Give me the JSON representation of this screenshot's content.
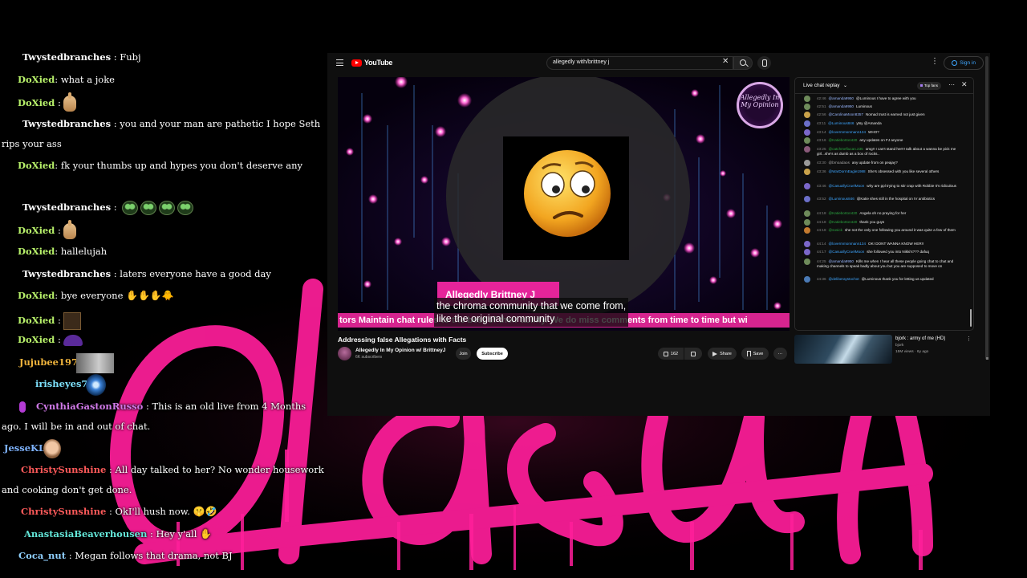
{
  "background": {
    "graffiti_text": "Old Soul",
    "accent": "#ff1e9a"
  },
  "chat": [
    {
      "user": "Twystedbranches",
      "color": "#ffffff",
      "text": ": Fubj"
    },
    {
      "user": "DoXied",
      "color": "#b7f06a",
      "text": ": what a joke"
    },
    {
      "user": "DoXied",
      "color": "#b7f06a",
      "text": ":"
    },
    {
      "user": "Twystedbranches",
      "color": "#ffffff",
      "text": ": you and your man are pathetic I hope Seth",
      "text2": "rips your ass"
    },
    {
      "user": "DoXied",
      "color": "#b7f06a",
      "text": ": fk your thumbs up and hypes you don't deserve any"
    },
    {
      "user": "Twystedbranches",
      "color": "#ffffff",
      "text": ":"
    },
    {
      "user": "DoXied",
      "color": "#b7f06a",
      "text": ":"
    },
    {
      "user": "DoXied",
      "color": "#b7f06a",
      "text": ": hallelujah"
    },
    {
      "user": "Twystedbranches",
      "color": "#ffffff",
      "text": ": laters everyone have a good day"
    },
    {
      "user": "DoXied",
      "color": "#b7f06a",
      "text": ": bye everyone"
    },
    {
      "user": "DoXied",
      "color": "#b7f06a",
      "text": ":"
    },
    {
      "user": "DoXied",
      "color": "#b7f06a",
      "text": ":"
    },
    {
      "user": "Jujubee1973",
      "color": "#f0b43c",
      "text": ":"
    },
    {
      "user": "irisheyes78",
      "color": "#7fe3ff",
      "text": ":"
    },
    {
      "user": "CynthiaGastonRusso",
      "color": "#d07ae8",
      "text": ": This is an old live from 4 Months",
      "text2": "ago. I will be in and out of chat."
    },
    {
      "user": "JesseKL",
      "color": "#7fb4ff",
      "text": ":"
    },
    {
      "user": "ChristySunshine",
      "color": "#ff5a5a",
      "text": ": All day talked to her? No wonder housework",
      "text2": "and cooking don't get done."
    },
    {
      "user": "ChristySunshine",
      "color": "#ff5a5a",
      "text": ": OkI'll hush now."
    },
    {
      "user": "AnastasiaBeaverhousen",
      "color": "#63e6d8",
      "text": ": Hey y'all"
    },
    {
      "user": "Coca_nut",
      "color": "#8fd0ff",
      "text": ": Megan follows that drama, not BJ"
    }
  ],
  "youtube": {
    "logo": "YouTube",
    "search_value": "allegedly with/brittney j",
    "signin": "Sign in",
    "video": {
      "lower_title": "Allegedly Brittney J",
      "ticker": "tors Maintain chat rules to the best of their ability. We do miss comments from time to time but wi",
      "caption_1": "the chroma community that we come from,",
      "caption_2": "like the original community",
      "seal": "Allegedly In My Opinion"
    },
    "title": "Addressing false Allegations with Facts",
    "channel": "Allegedly In My Opinion w/ BrittneyJ",
    "subs": "6K subscribers",
    "join": "Join",
    "subscribe": "Subscribe",
    "likes": "162",
    "share": "Share",
    "save": "Save",
    "live_chat": {
      "title": "Live chat replay",
      "top_fans": "Top fans",
      "messages": [
        {
          "ts": "42:46",
          "name": "@amanda9950",
          "color": "#9ab8ff",
          "text": "@Luminous I have to agree with you"
        },
        {
          "ts": "42:51",
          "name": "@amanda9950",
          "color": "#9ab8ff",
          "text": "Luminous"
        },
        {
          "ts": "42:56",
          "name": "@CarolinaMoon8357",
          "color": "#9ab8ff",
          "text": "Nomad trust is earned not just given"
        },
        {
          "ts": "43:11",
          "name": "@Luminous846",
          "color": "#3ea6ff",
          "text": "ytsy @Amanda"
        },
        {
          "ts": "43:14",
          "name": "@lovermmonmann134",
          "color": "#3ea6ff",
          "text": "WHO?"
        },
        {
          "ts": "43:16",
          "name": "@Katieborton420",
          "color": "#2ba640",
          "text": "any updates on FJ anyone"
        },
        {
          "ts": "43:25",
          "name": "@catchmefiucan.235",
          "color": "#2ba640",
          "text": "omg!! I can't stand her!!! talk about a wanna be pick me girl...she's as dumb as a box of rocks.."
        },
        {
          "ts": "43:30",
          "name": "@brnoadaos",
          "color": "#aaaaaa",
          "text": "any update from on peajay?"
        },
        {
          "ts": "43:36",
          "name": "@WarDormEagle1988",
          "color": "#3ea6ff",
          "text": "She's obsessed with you like several others"
        },
        {
          "ts": "43:46",
          "name": "@CasuallyCruelMoon",
          "color": "#3ea6ff",
          "text": "why are ppl trying to stir crap with Robbie It's ridiculous"
        },
        {
          "ts": "43:52",
          "name": "@Luminous846",
          "color": "#3ea6ff",
          "text": "@Katie shes still in the hospital on IV antibiotics"
        },
        {
          "ts": "44:18",
          "name": "@Katieborton420",
          "color": "#2ba640",
          "text": "Angela oh no praying for her"
        },
        {
          "ts": "44:18",
          "name": "@Katieborton420",
          "color": "#2ba640",
          "text": "thank you guys"
        },
        {
          "ts": "44:18",
          "name": "@sosick",
          "color": "#2ba640",
          "text": "she not the only one following you around it was quite a few of them"
        },
        {
          "ts": "44:14",
          "name": "@lovermmonmann134",
          "color": "#3ea6ff",
          "text": "OK! DONT WANNA KNOW HER!!"
        },
        {
          "ts": "44:17",
          "name": "@CasuallyCruelMoon",
          "color": "#3ea6ff",
          "text": "she followed you into Nikki's??? dafuq"
        },
        {
          "ts": "44:25",
          "name": "@amanda9950",
          "color": "#9ab8ff",
          "text": "Kills me when I hear all these people going chat to chat and making channels to speak badly about you but you are supposed to move on"
        },
        {
          "ts": "44:36",
          "name": "@deliberaystochot",
          "color": "#3ea6ff",
          "text": "@Luminous thank you for letting us updated"
        }
      ]
    },
    "up_next": {
      "title": "bjork : army of me (HD)",
      "channel": "bjork",
      "meta": "15M views · 6y ago"
    }
  }
}
